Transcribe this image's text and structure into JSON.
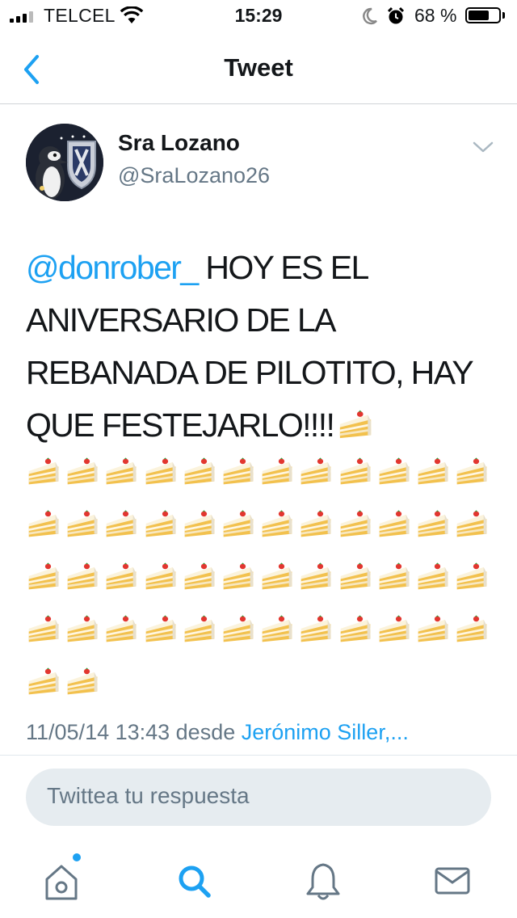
{
  "status_bar": {
    "carrier": "TELCEL",
    "time": "15:29",
    "battery_percent": "68 %"
  },
  "nav": {
    "title": "Tweet"
  },
  "tweet": {
    "author_name": "Sra Lozano",
    "author_handle": "@SraLozano26",
    "mention": "@donrober_",
    "text": " HOY ES EL ANIVERSARIO DE LA REBANADA DE PILOTITO, HAY QUE FESTEJARLO!!!!",
    "emoji_icon": "shortcake-icon",
    "emoji_count_inline": 1,
    "emoji_count_grid": 50,
    "timestamp": "11/05/14 13:43 desde",
    "place": "Jerónimo Siller,..."
  },
  "reply": {
    "placeholder": "Twittea tu respuesta"
  },
  "tabbar": {
    "items": [
      {
        "icon": "home-icon",
        "active": false,
        "badge_dot": true
      },
      {
        "icon": "search-icon",
        "active": true
      },
      {
        "icon": "notifications-bell-icon",
        "active": false
      },
      {
        "icon": "messages-envelope-icon",
        "active": false
      }
    ]
  },
  "colors": {
    "accent": "#1da1f2",
    "secondary_text": "#657786",
    "primary_text": "#14171a",
    "reply_bg": "#e6ecf0",
    "avatar_bg": "#1b2130"
  }
}
